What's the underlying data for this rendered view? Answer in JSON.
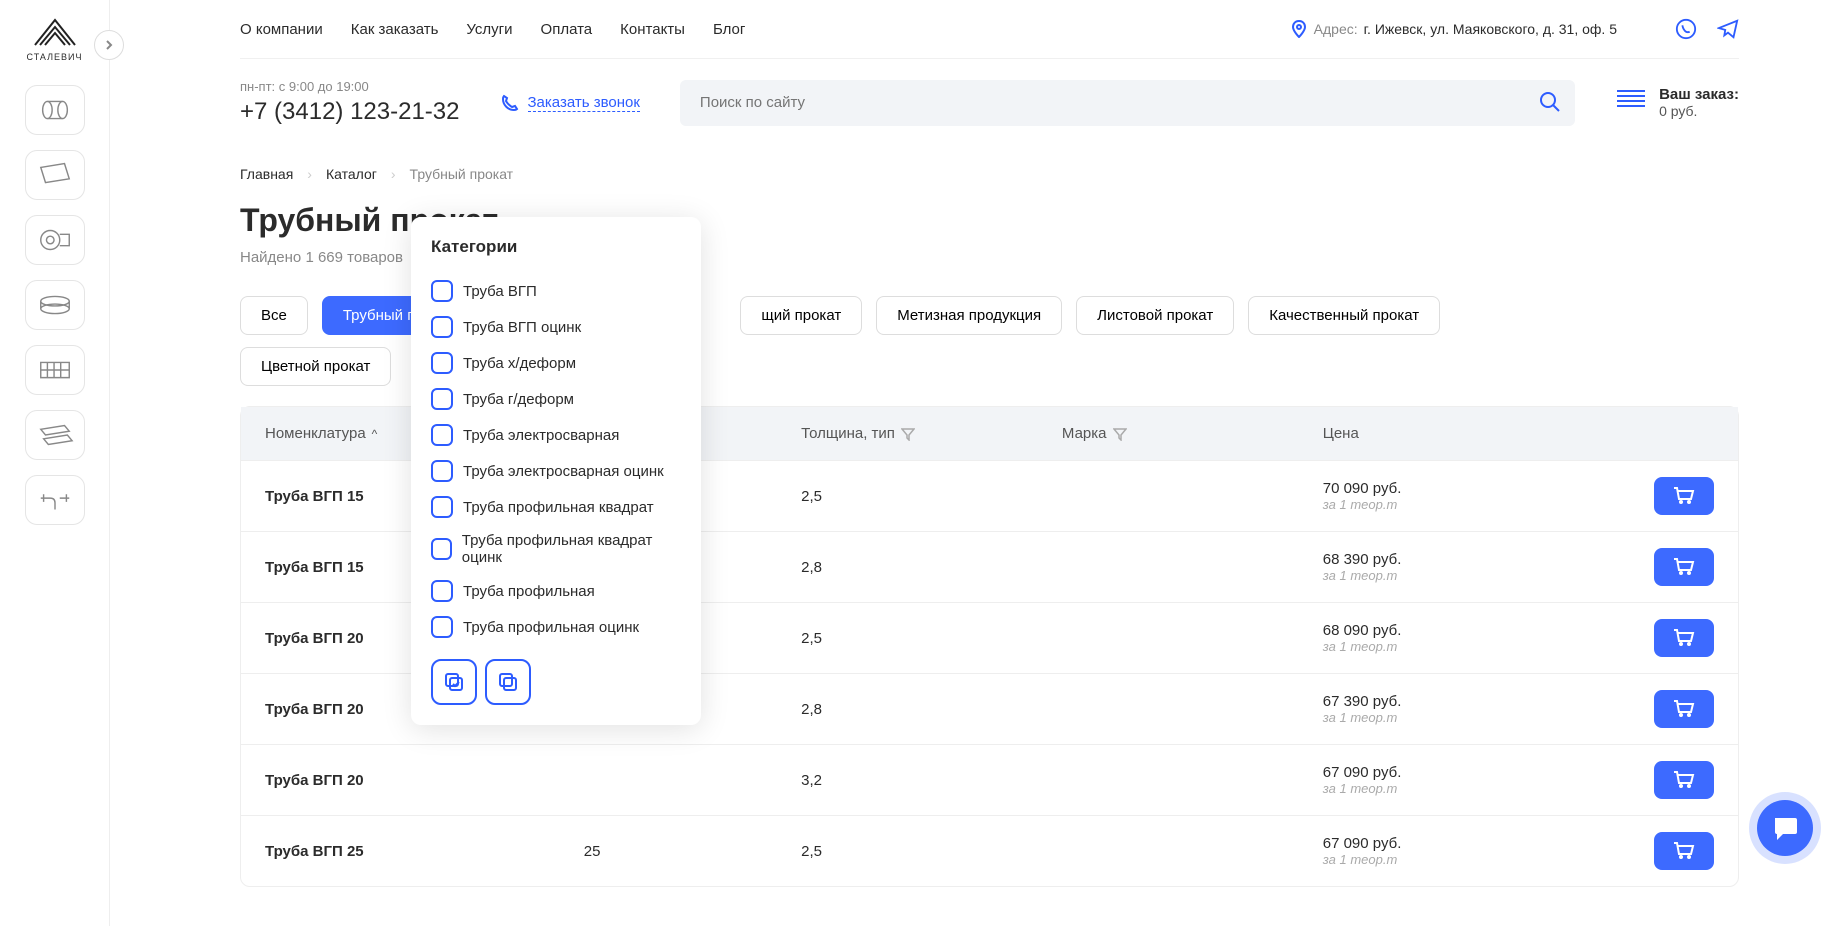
{
  "brand": "СТАЛЕВИЧ",
  "nav": {
    "items": [
      "О компании",
      "Как заказать",
      "Услуги",
      "Оплата",
      "Контакты",
      "Блог"
    ]
  },
  "address": {
    "label": "Адрес:",
    "value": "г. Ижевск, ул. Маяковского, д. 31, оф. 5"
  },
  "contact": {
    "hours": "пн-пт: с 9:00 до 19:00",
    "phone": "+7 (3412) 123-21-32",
    "callback": "Заказать звонок"
  },
  "search": {
    "placeholder": "Поиск по сайту"
  },
  "cart": {
    "label": "Ваш заказ:",
    "value": "0 руб."
  },
  "breadcrumbs": {
    "home": "Главная",
    "catalog": "Каталог",
    "current": "Трубный прокат"
  },
  "page": {
    "title": "Трубный прокат",
    "results": "Найдено 1 669 товаров"
  },
  "categories": [
    "Все",
    "Трубный п",
    "щий прокат",
    "Метизная продукция",
    "Листовой прокат",
    "Качественный прокат",
    "Цветной прокат"
  ],
  "dropdown": {
    "title": "Категории",
    "items": [
      "Труба ВГП",
      "Труба ВГП оцинк",
      "Труба х/деформ",
      "Труба г/деформ",
      "Труба электросварная",
      "Труба электросварная оцинк",
      "Труба профильная квадрат",
      "Труба профильная квадрат оцинк",
      "Труба профильная",
      "Труба профильная оцинк"
    ]
  },
  "table": {
    "headers": {
      "name": "Номенклатура",
      "diameter": "",
      "thickness": "Толщина, тип",
      "grade": "Марка",
      "price": "Цена"
    },
    "unit_label": "за 1 теор.т",
    "rows": [
      {
        "name": "Труба ВГП 15",
        "d": "",
        "t": "2,5",
        "m": "",
        "price": "70 090 руб."
      },
      {
        "name": "Труба ВГП 15",
        "d": "",
        "t": "2,8",
        "m": "",
        "price": "68 390 руб."
      },
      {
        "name": "Труба ВГП 20",
        "d": "",
        "t": "2,5",
        "m": "",
        "price": "68 090 руб."
      },
      {
        "name": "Труба ВГП 20",
        "d": "",
        "t": "2,8",
        "m": "",
        "price": "67 390 руб."
      },
      {
        "name": "Труба ВГП 20",
        "d": "",
        "t": "3,2",
        "m": "",
        "price": "67 090 руб."
      },
      {
        "name": "Труба ВГП 25",
        "d": "25",
        "t": "2,5",
        "m": "",
        "price": "67 090 руб."
      }
    ]
  }
}
